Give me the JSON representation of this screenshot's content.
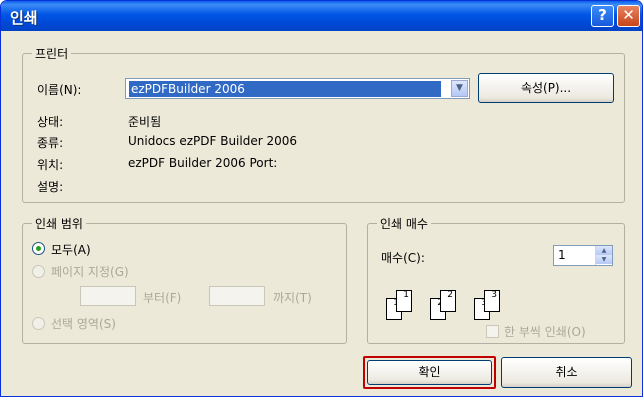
{
  "window": {
    "title": "인쇄",
    "help_label": "?",
    "close_label": "✕"
  },
  "printer": {
    "group_label": "프린터",
    "name_label": "이름(N):",
    "name_value": "ezPDFBuilder 2006",
    "properties_label": "속성(P)...",
    "status_label": "상태:",
    "status_value": "준비됨",
    "type_label": "종류:",
    "type_value": "Unidocs ezPDF Builder 2006",
    "where_label": "위치:",
    "where_value": "ezPDF Builder 2006 Port:",
    "comment_label": "설명:"
  },
  "range": {
    "group_label": "인쇄 범위",
    "all_label": "모두(A)",
    "pages_label": "페이지 지정(G)",
    "from_label": "부터(F)",
    "to_label": "까지(T)",
    "selection_label": "선택 영역(S)",
    "selected": "all"
  },
  "copies": {
    "group_label": "인쇄 매수",
    "count_label": "매수(C):",
    "count_value": "1",
    "collate_label": "한 부씩 인쇄(O)",
    "collate_checked": false,
    "page_labels": [
      "1",
      "1",
      "2",
      "2",
      "3",
      "3"
    ]
  },
  "buttons": {
    "ok_label": "확인",
    "cancel_label": "취소"
  },
  "colors": {
    "titlebar": "#0055e5",
    "dialog_bg": "#ece9d8",
    "selection": "#316ac5",
    "focus_border": "#c00000"
  },
  "icons": {
    "help": "help-icon",
    "close": "close-icon",
    "dropdown": "chevron-down-icon"
  }
}
